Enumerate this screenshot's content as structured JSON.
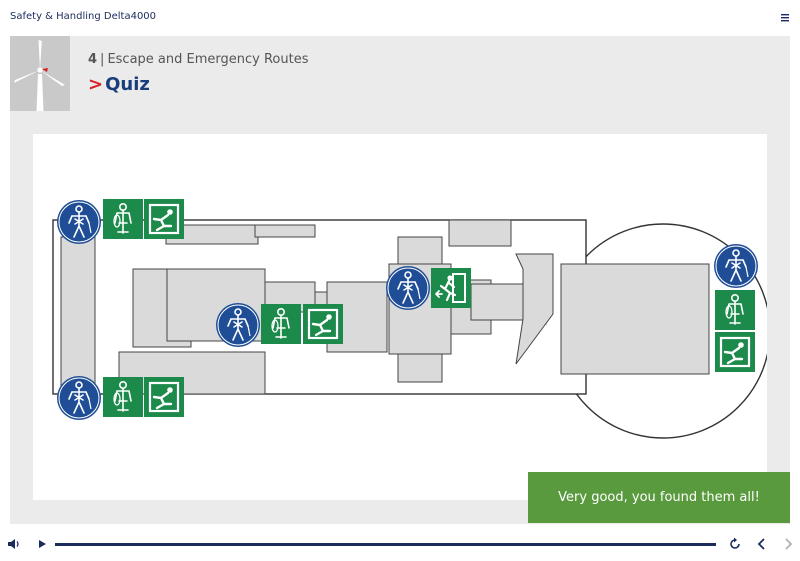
{
  "app": {
    "title": "Safety & Handling Delta4000"
  },
  "chapter": {
    "number": "4",
    "separator": "|",
    "title": "Escape and Emergency Routes"
  },
  "page": {
    "chevron": ">",
    "title": "Quiz"
  },
  "feedback": {
    "message": "Very good, you found them all!"
  },
  "colors": {
    "navy": "#1a2b5c",
    "sign_blue": "#1f4e96",
    "sign_green": "#1c8a4a",
    "feedback_green": "#5a9a3e",
    "accent_red": "#d62027"
  },
  "icons": {
    "menu": "hamburger-icon",
    "audio": "speaker-icon",
    "play": "play-icon",
    "replay": "replay-icon",
    "prev": "chevron-left-icon",
    "next": "chevron-right-icon",
    "harness_sign": "safety-harness-mandatory-sign",
    "descender_sign": "rescue-descender-sign",
    "hatch_exit_sign": "emergency-hatch-exit-sign",
    "running_exit_sign": "emergency-exit-running-man-sign"
  }
}
